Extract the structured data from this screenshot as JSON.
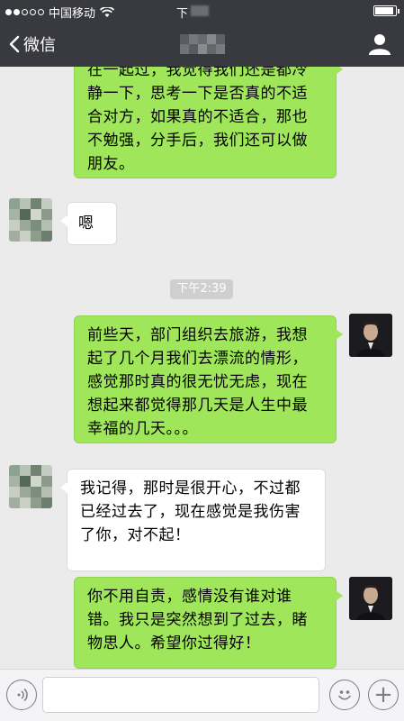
{
  "status_bar": {
    "carrier": "中国移动",
    "time": "下",
    "battery_level": 0.9,
    "signal_bars_filled": 2,
    "signal_bars_total": 5
  },
  "nav": {
    "back_label": "微信",
    "icons": {
      "back": "chevron-left-icon",
      "contact": "person-icon"
    }
  },
  "messages": [
    {
      "side": "me",
      "text": "在一起过，我觉得我们还是都冷静一下，思考一下是否真的不适合对方，如果真的不适合，那也不勉强，分手后，我们还可以做朋友。"
    },
    {
      "side": "other",
      "text": "嗯"
    },
    {
      "side": "me",
      "text": "前些天，部门组织去旅游，我想起了几个月我们去漂流的情形，感觉那时真的很无忧无虑，现在想起来都觉得那几天是人生中最幸福的几天。。。"
    },
    {
      "side": "other",
      "text": "我记得，那时是很开心，不过都已经过去了，现在感觉是我伤害了你，对不起！"
    },
    {
      "side": "me",
      "text": "你不用自责，感情没有谁对谁错。我只是突然想到了过去，睹物思人。希望你过得好！"
    }
  ],
  "timestamp": "下午2:39",
  "input_bar": {
    "placeholder": "",
    "plus_label": "+",
    "icons": {
      "voice": "voice-icon",
      "emoji": "emoji-icon",
      "plus": "plus-icon"
    }
  },
  "colors": {
    "header": "#393a3f",
    "chat_bg": "#ebebeb",
    "my_bubble": "#9fe65a",
    "other_bubble": "#ffffff"
  }
}
